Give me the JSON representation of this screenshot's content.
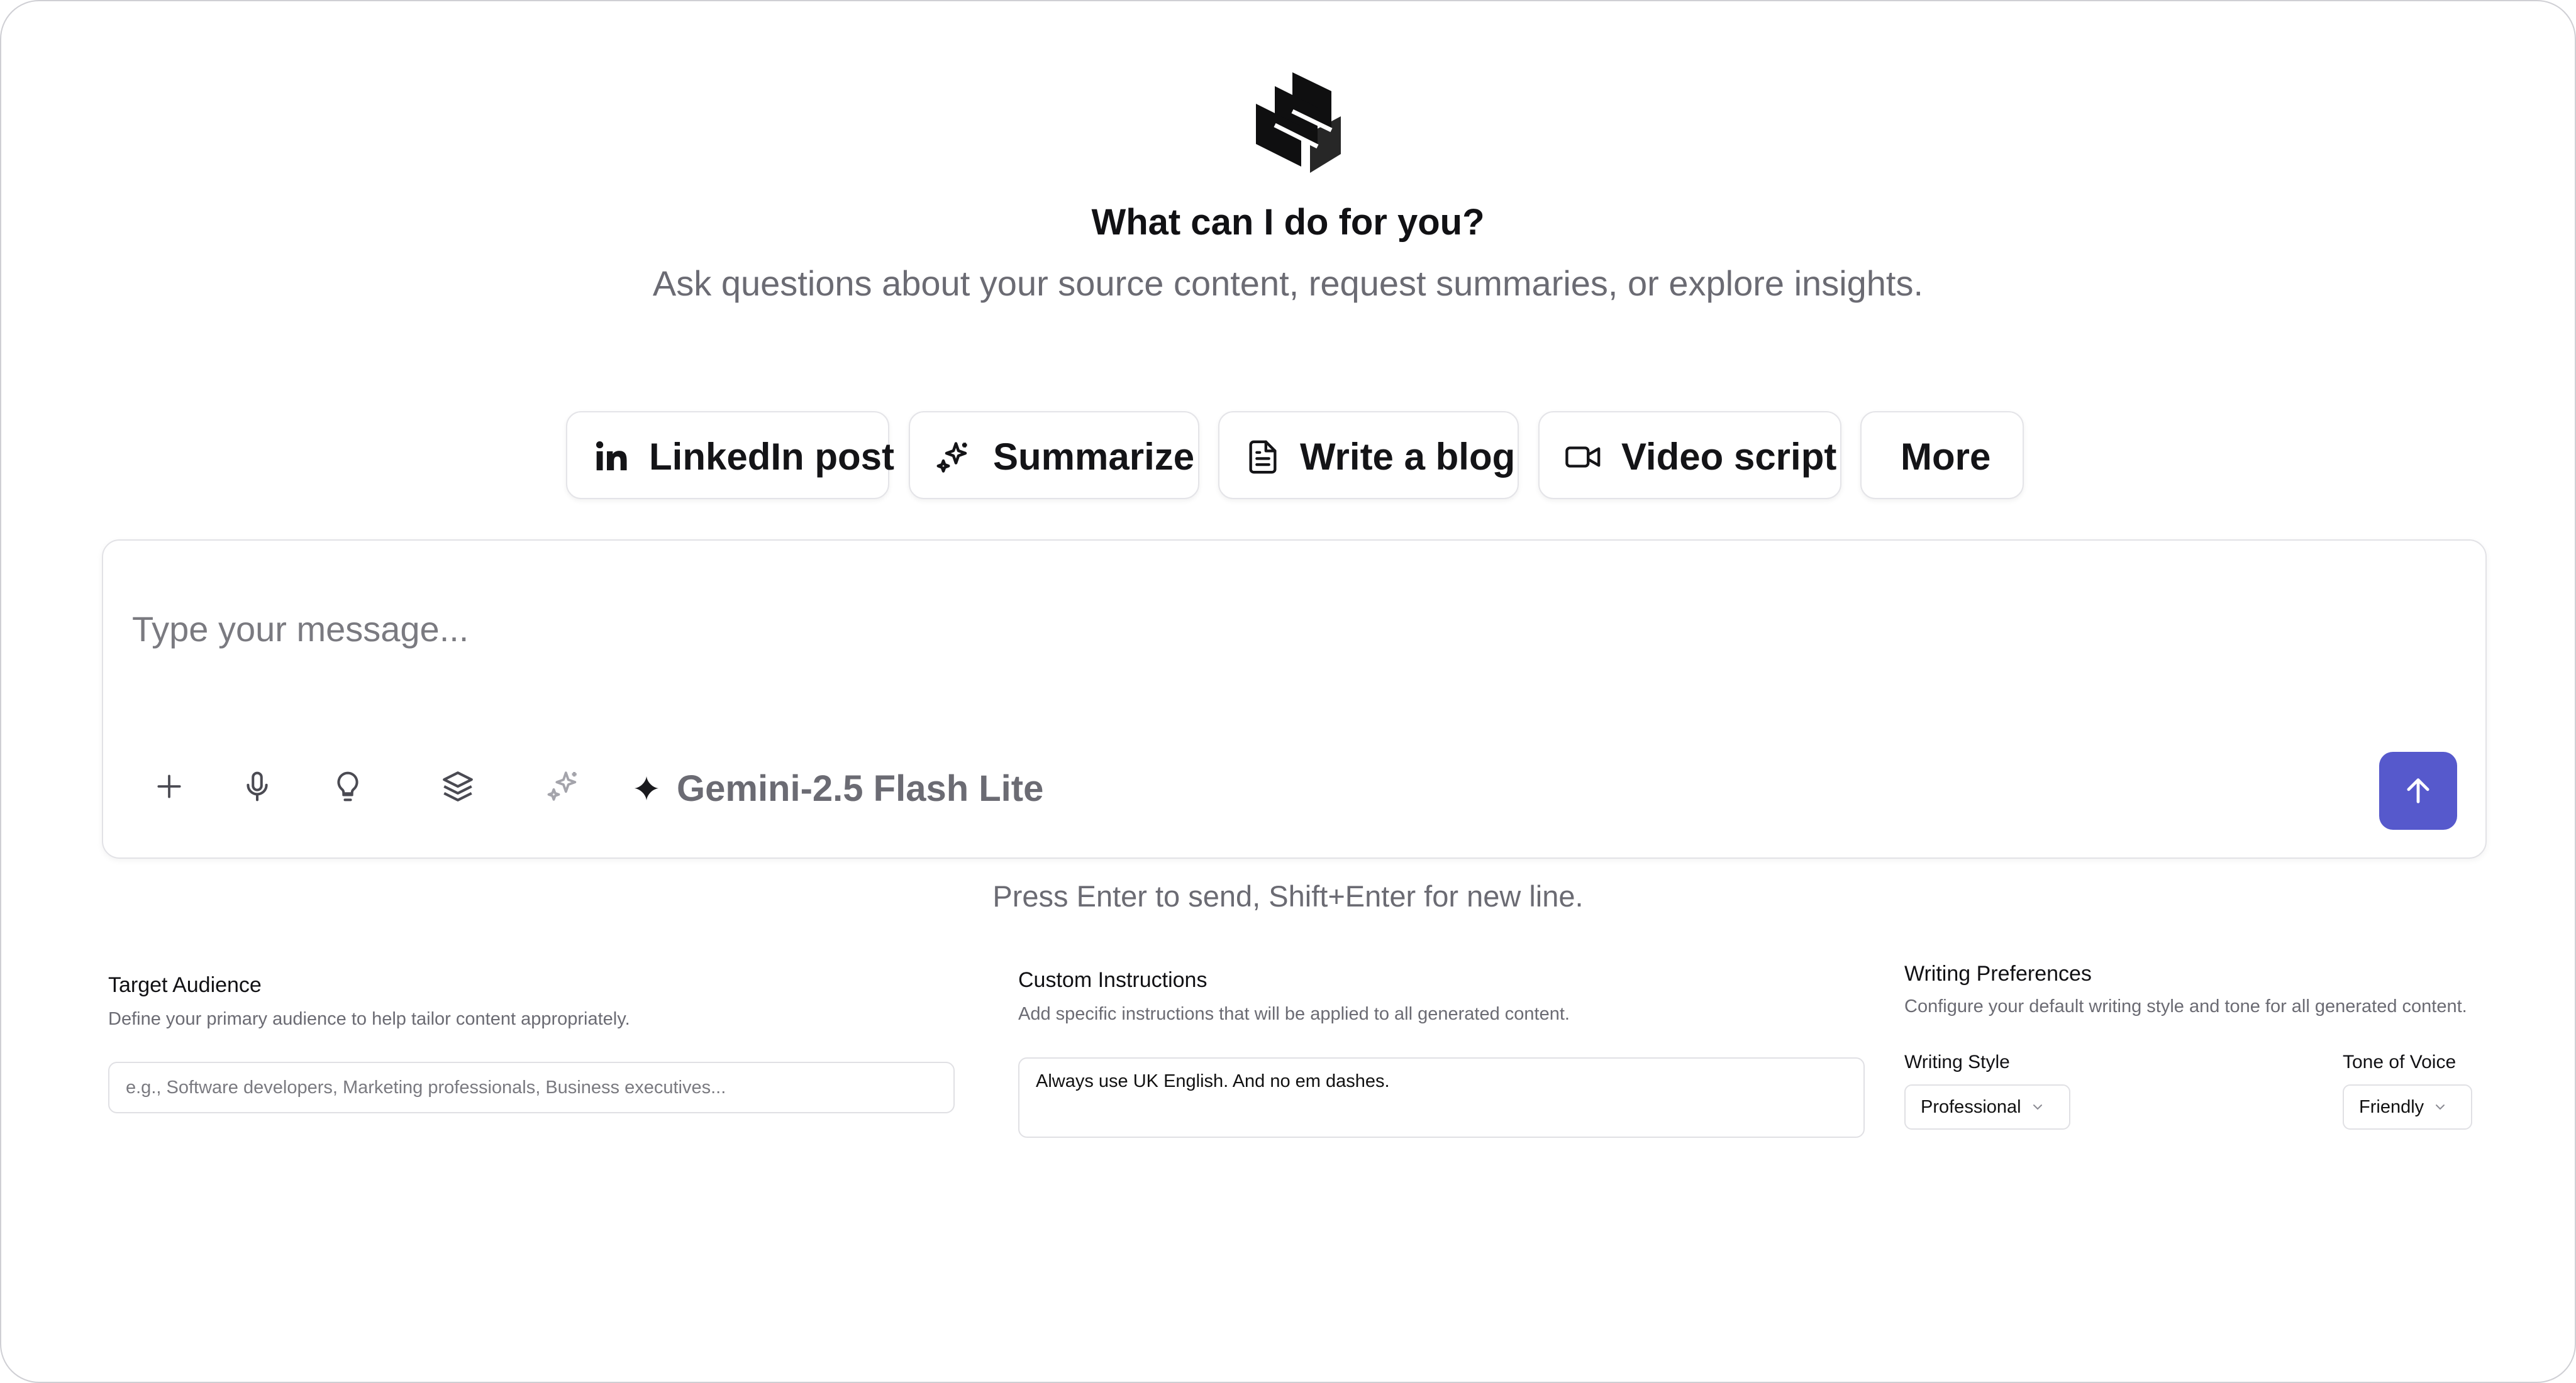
{
  "header": {
    "logo": "stacked-layers-logo",
    "title": "What can I do for you?",
    "subtitle": "Ask questions about your source content, request summaries, or explore insights."
  },
  "quick_actions": [
    {
      "label": "LinkedIn post",
      "icon": "linkedin-icon"
    },
    {
      "label": "Summarize",
      "icon": "sparkles-icon"
    },
    {
      "label": "Write a blog",
      "icon": "document-icon"
    },
    {
      "label": "Video script",
      "icon": "video-camera-icon"
    },
    {
      "label": "More",
      "icon": ""
    }
  ],
  "composer": {
    "placeholder": "Type your message...",
    "value": "",
    "tools": [
      "plus-icon",
      "microphone-icon",
      "lightbulb-icon",
      "layers-icon",
      "sparkles-icon"
    ],
    "model_icon": "four-point-star-icon",
    "model": "Gemini-2.5 Flash Lite",
    "send_icon": "arrow-up-icon",
    "accent_color": "#5659cc"
  },
  "hint": "Press Enter to send, Shift+Enter for new line.",
  "settings": {
    "target_audience": {
      "title": "Target Audience",
      "description": "Define your primary audience to help tailor content appropriately.",
      "placeholder": "e.g., Software developers, Marketing professionals, Business executives...",
      "value": ""
    },
    "custom_instructions": {
      "title": "Custom Instructions",
      "description": "Add specific instructions that will be applied to all generated content.",
      "value": "Always use UK English. And no em dashes."
    },
    "writing_preferences": {
      "title": "Writing Preferences",
      "description": "Configure your default writing style and tone for all generated content.",
      "writing_style_label": "Writing Style",
      "writing_style_value": "Professional",
      "tone_label": "Tone of Voice",
      "tone_value": "Friendly"
    }
  }
}
